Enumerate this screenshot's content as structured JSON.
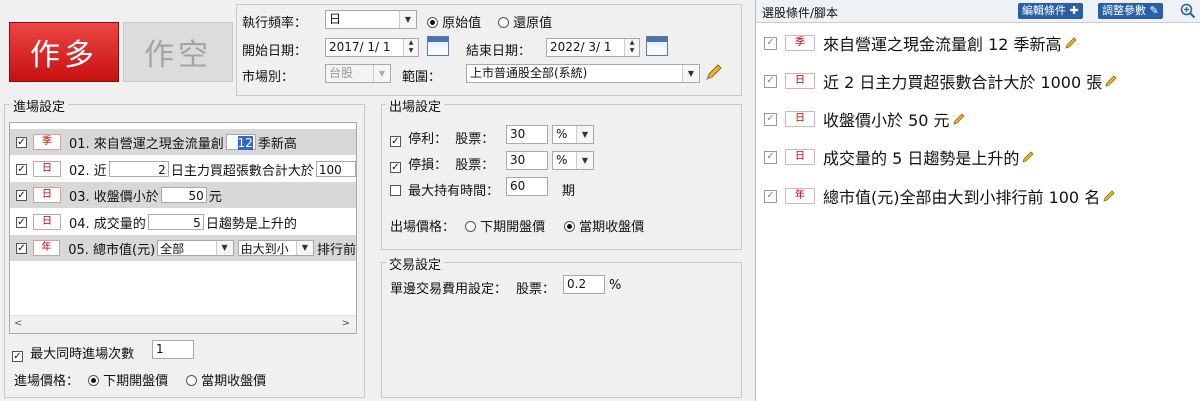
{
  "buttons": {
    "long": "作多",
    "short": "作空"
  },
  "top": {
    "freq_label": "執行頻率：",
    "freq_value": "日",
    "radio_raw": "原始值",
    "radio_restore": "還原值",
    "start_label": "開始日期：",
    "start_value": "2017/ 1/ 1",
    "end_label": "結束日期：",
    "end_value": "2022/ 3/ 1",
    "market_label": "市場別：",
    "market_value": "台股",
    "range_label": "範圍：",
    "range_value": "上市普通股全部(系統)"
  },
  "entry": {
    "title": "進場設定",
    "rows": [
      {
        "badge": "季",
        "pre": "01. 來自營運之現金流量創",
        "v1": "12",
        "post": "季新高",
        "selected": true
      },
      {
        "badge": "日",
        "pre": "02. 近",
        "v1": "2",
        "post": "日主力買超張數合計大於",
        "v2": "100",
        "selected": false
      },
      {
        "badge": "日",
        "pre": "03. 收盤價小於",
        "v1": "50",
        "post": "元",
        "selected": true
      },
      {
        "badge": "日",
        "pre": "04. 成交量的",
        "v1": "5",
        "post": "日趨勢是上升的",
        "selected": false
      },
      {
        "badge": "年",
        "pre": "05. 總市值(元)",
        "d1": "全部",
        "d2": "由大到小",
        "post": "排行前",
        "selected": true
      }
    ],
    "max_label": "最大同時進場次數",
    "max_value": "1",
    "price_label": "進場價格：",
    "price_next_open": "下期開盤價",
    "price_close": "當期收盤價"
  },
  "exit": {
    "title": "出場設定",
    "tp_label": "停利：",
    "tp_stock": "股票：",
    "tp_value": "30",
    "tp_unit": "%",
    "sl_label": "停損：",
    "sl_stock": "股票：",
    "sl_value": "30",
    "sl_unit": "%",
    "hold_label": "最大持有時間：",
    "hold_value": "60",
    "hold_unit": "期",
    "price_label": "出場價格：",
    "price_next_open": "下期開盤價",
    "price_close": "當期收盤價"
  },
  "trade": {
    "title": "交易設定",
    "fee_label": "單邊交易費用設定：",
    "fee_stock": "股票：",
    "fee_value": "0.2",
    "fee_unit": "%"
  },
  "panel": {
    "title": "選股條件/腳本",
    "edit_btn": "編輯條件",
    "adjust_btn": "調整參數",
    "items": [
      {
        "badge": "季",
        "text": "來自營運之現金流量創 12 季新高"
      },
      {
        "badge": "日",
        "text": "近 2 日主力買超張數合計大於 1000 張"
      },
      {
        "badge": "日",
        "text": "收盤價小於 50 元"
      },
      {
        "badge": "日",
        "text": "成交量的 5 日趨勢是上升的"
      },
      {
        "badge": "年",
        "text": "總市值(元)全部由大到小排行前 100 名"
      }
    ]
  }
}
